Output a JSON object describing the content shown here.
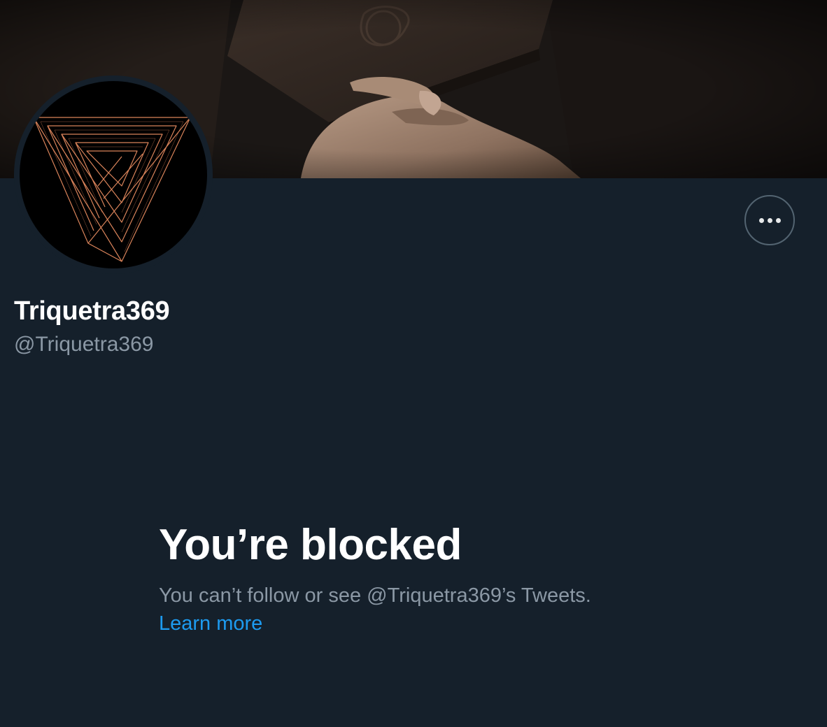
{
  "profile": {
    "display_name": "Triquetra369",
    "handle": "@Triquetra369"
  },
  "actions": {
    "more_icon": "more-horizontal-icon"
  },
  "blocked": {
    "title": "You’re blocked",
    "message": "You can’t follow or see @Triquetra369’s Tweets.",
    "learn_more": "Learn more"
  },
  "colors": {
    "background": "#15202b",
    "link": "#1d9bf0",
    "muted_text": "#8b98a5",
    "logo_lines": "#d9835a"
  }
}
